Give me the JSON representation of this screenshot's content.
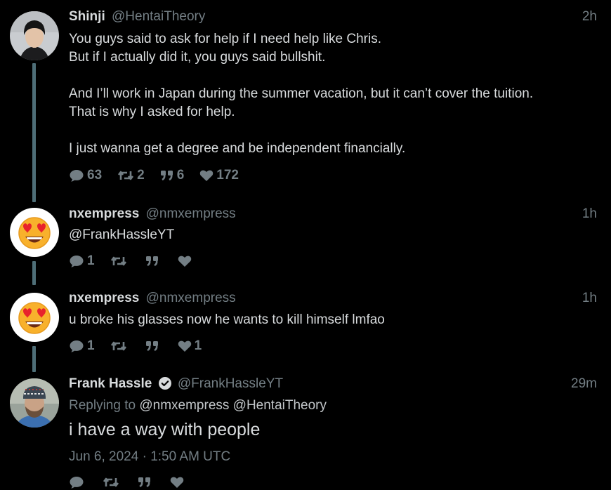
{
  "tweets": [
    {
      "name": "Shinji",
      "handle": "@HentaiTheory",
      "time": "2h",
      "lines": [
        "You guys said to ask for help if I need help like Chris.",
        "But if I actually did it, you guys said bullshit.",
        "",
        "And I’ll work in Japan during the summer vacation, but it can’t cover the tuition.",
        "That is why I asked for help.",
        "",
        "I just wanna get a degree and be independent financially."
      ],
      "stats": {
        "replies": "63",
        "retweets": "2",
        "quotes": "6",
        "likes": "172"
      }
    },
    {
      "name": "nxempress",
      "handle": "@nmxempress",
      "time": "1h",
      "text": "@FrankHassleYT",
      "stats": {
        "replies": "1",
        "retweets": "",
        "quotes": "",
        "likes": ""
      }
    },
    {
      "name": "nxempress",
      "handle": "@nmxempress",
      "time": "1h",
      "text": "u broke his glasses now he wants to kill himself lmfao",
      "stats": {
        "replies": "1",
        "retweets": "",
        "quotes": "",
        "likes": "1"
      }
    },
    {
      "name": "Frank Hassle",
      "handle": "@FrankHassleYT",
      "time": "29m",
      "verified": true,
      "replying_prefix": "Replying to",
      "replying_to": "@nmxempress @HentaiTheory",
      "text": "i have a way with people",
      "date": "Jun 6, 2024 · 1:50 AM UTC",
      "stats": {
        "replies": "",
        "retweets": "",
        "quotes": "",
        "likes": ""
      }
    }
  ],
  "icons": {
    "reply": "comment-bubble-icon",
    "retweet": "retweet-icon",
    "quote": "quote-icon",
    "like": "heart-icon",
    "verified": "verified-badge-icon"
  },
  "colors": {
    "background": "#000000",
    "text": "#d8dbdd",
    "muted": "#737e84",
    "thread_line": "#4e6e77"
  }
}
